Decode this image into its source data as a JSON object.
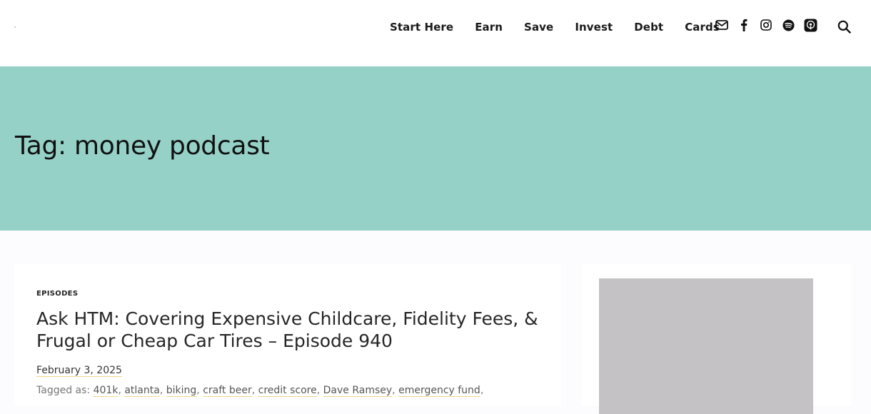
{
  "nav": {
    "items": [
      {
        "label": "Start Here"
      },
      {
        "label": "Earn"
      },
      {
        "label": "Save"
      },
      {
        "label": "Invest"
      },
      {
        "label": "Debt"
      },
      {
        "label": "Cards"
      }
    ],
    "social_icons": [
      "email-icon",
      "facebook-icon",
      "instagram-icon",
      "spotify-icon",
      "apple-podcasts-icon"
    ],
    "search_icon": "search-icon"
  },
  "hero": {
    "title": "Tag: money podcast",
    "background": "#95d1c7"
  },
  "post": {
    "category": "EPISODES",
    "title": "Ask HTM: Covering Expensive Childcare, Fidelity Fees, & Frugal or Cheap Car Tires – Episode 940",
    "date": "February 3, 2025",
    "tagged_prefix": "Tagged as:",
    "tags": [
      "401k",
      "atlanta",
      "biking",
      "craft beer",
      "credit score",
      "Dave Ramsey",
      "emergency fund"
    ]
  },
  "colors": {
    "accent_underline": "#f0d488",
    "placeholder_gray": "#c4c2c5"
  }
}
